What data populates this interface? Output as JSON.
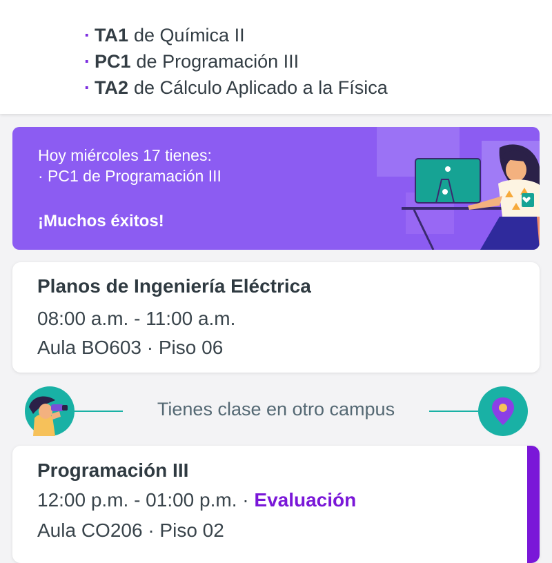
{
  "exams_summary": {
    "items": [
      {
        "bullet": "·",
        "code": "TA1",
        "rest": "de Química II"
      },
      {
        "bullet": "·",
        "code": "PC1",
        "rest": "de Programación III"
      },
      {
        "bullet": "·",
        "code": "TA2",
        "rest": "de Cálculo Aplicado a la Física"
      }
    ]
  },
  "banner": {
    "line1": "Hoy miércoles 17 tienes:",
    "line2": "· PC1 de Programación III",
    "cta": "¡Muchos éxitos!",
    "background_color": "#8c5cf2",
    "illustration": "student-at-computer-illustration"
  },
  "class_cards": [
    {
      "title": "Planos de Ingeniería Eléctrica",
      "time": "08:00 a.m. - 11:00 a.m.",
      "location": "Aula BO603 · Piso 06"
    },
    {
      "title": "Programación III",
      "time": "12:00 p.m. - 01:00 p.m.",
      "separator": " · ",
      "tag": "Evaluación",
      "location": "Aula CO206 · Piso 02",
      "accent_color": "#7a17d8"
    }
  ],
  "campus_notice": {
    "text": "Tienes clase en otro campus",
    "left_icon": "binoculars-person-icon",
    "right_icon": "location-pin-icon",
    "accent_color": "#19b1a5"
  }
}
